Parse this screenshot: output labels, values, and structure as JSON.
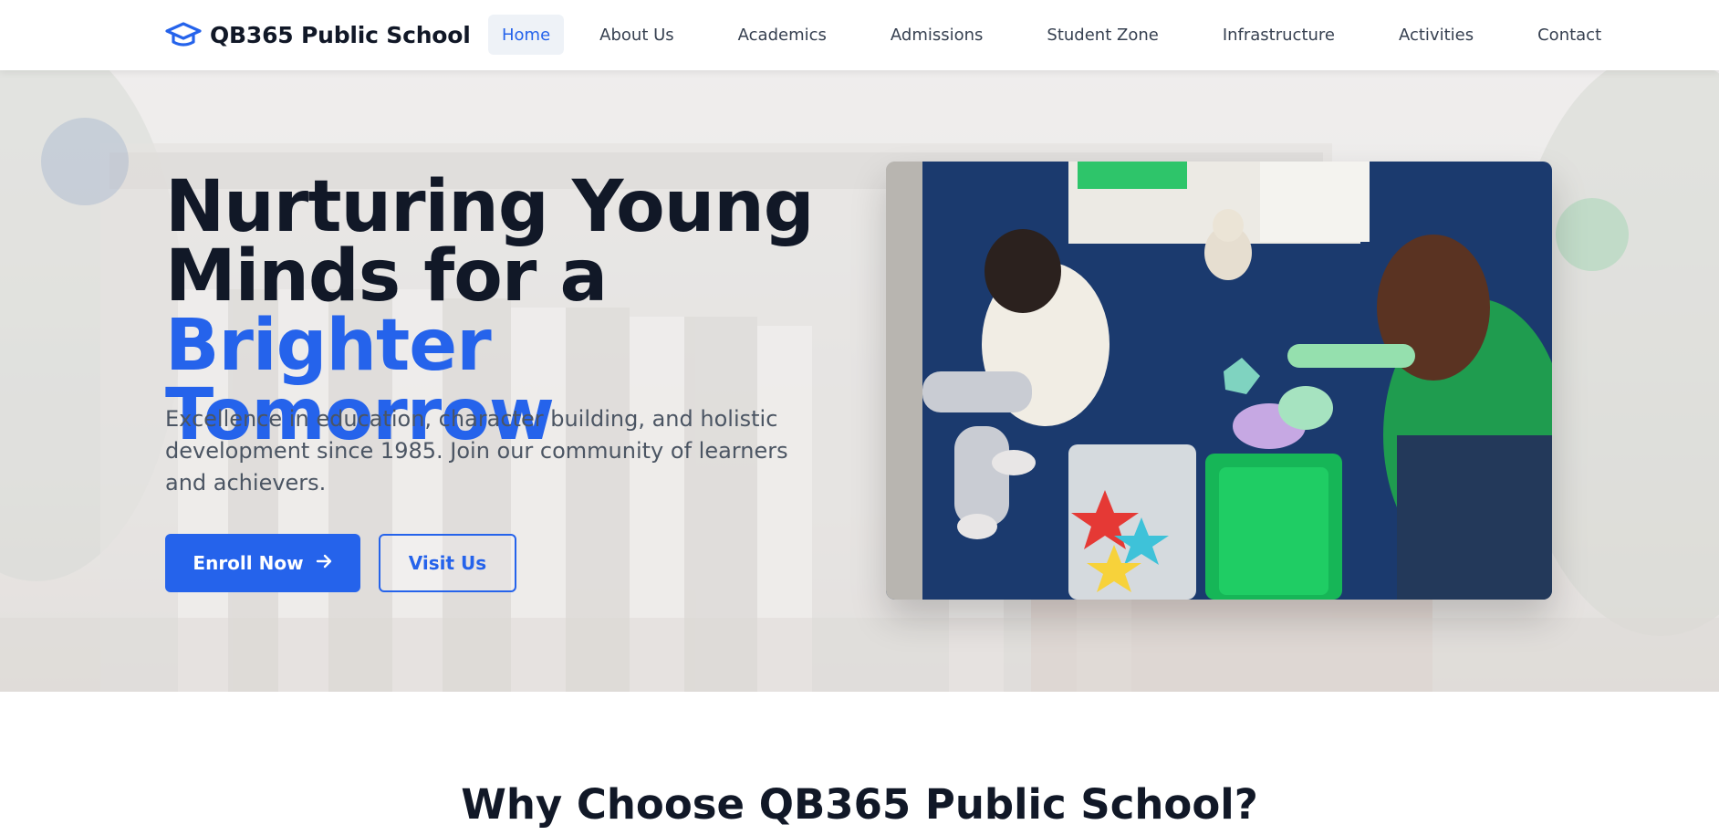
{
  "brand": {
    "name": "QB365 Public School",
    "icon": "graduation-cap-icon"
  },
  "nav": {
    "items": [
      {
        "label": "Home",
        "active": true
      },
      {
        "label": "About Us",
        "active": false
      },
      {
        "label": "Academics",
        "active": false
      },
      {
        "label": "Admissions",
        "active": false
      },
      {
        "label": "Student Zone",
        "active": false
      },
      {
        "label": "Infrastructure",
        "active": false
      },
      {
        "label": "Activities",
        "active": false
      },
      {
        "label": "Contact",
        "active": false
      }
    ]
  },
  "hero": {
    "title_line1": "Nurturing Young",
    "title_line2": "Minds for a",
    "title_accent1": "Brighter",
    "title_accent2": "Tomorrow",
    "subtitle": "Excellence in education, character building, and holistic development since 1985. Join our community of learners and achievers.",
    "primary_button": "Enroll Now",
    "primary_button_icon": "arrow-right-icon",
    "secondary_button": "Visit Us"
  },
  "why": {
    "title": "Why Choose QB365 Public School?"
  },
  "colors": {
    "accent": "#2563eb",
    "heading": "#111827",
    "body_text": "#4b5563",
    "nav_active_bg": "#eef2f7"
  }
}
